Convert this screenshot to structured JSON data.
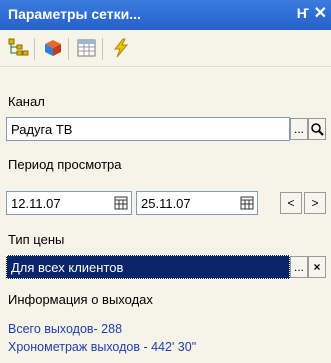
{
  "window": {
    "title": "Параметры сетки...",
    "pin_icon": "pin-icon",
    "close_icon": "close-icon"
  },
  "toolbar": {
    "icons": [
      "hierarchy-icon",
      "cube-icon",
      "grid-icon",
      "lightning-icon"
    ]
  },
  "channel": {
    "label": "Канал",
    "value": "Радуга ТВ"
  },
  "period": {
    "label": "Период просмотра",
    "from": "12.11.07",
    "to": "25.11.07",
    "prev_label": "<",
    "next_label": ">"
  },
  "price_type": {
    "label": "Тип цены",
    "value": "Для всех клиентов"
  },
  "info": {
    "label": "Информация о выходах",
    "total": "Всего выходов- 288",
    "duration": "Хронометраж выходов - 442' 30\""
  },
  "common": {
    "dots": "...",
    "clear": "×"
  }
}
